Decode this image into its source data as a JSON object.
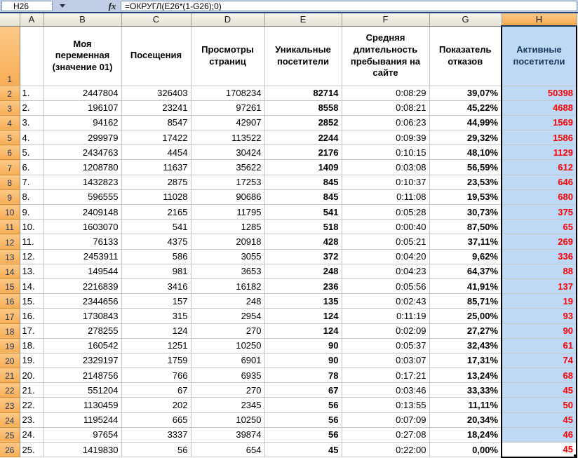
{
  "formula_bar": {
    "name_box": "H26",
    "fx_label": "fx",
    "formula": "=ОКРУГЛ(E26*(1-G26);0)"
  },
  "grid": {
    "column_letters": [
      "A",
      "B",
      "C",
      "D",
      "E",
      "F",
      "G",
      "H"
    ],
    "selected_column": "H",
    "header_row_number": "1",
    "headers": {
      "b": "Моя переменная (значение 01)",
      "c": "Посещения",
      "d": "Просмотры страниц",
      "e": "Уникальные посетители",
      "f": "Средняя длительность пребывания на сайте",
      "g": "Показатель отказов",
      "h": "Активные посетители"
    },
    "rows": [
      {
        "row": "2",
        "a": "1.",
        "b": "2447804",
        "c": "326403",
        "d": "1708234",
        "e": "82714",
        "f": "0:08:29",
        "g": "39,07%",
        "h": "50398"
      },
      {
        "row": "3",
        "a": "2.",
        "b": "196107",
        "c": "23241",
        "d": "97261",
        "e": "8558",
        "f": "0:08:21",
        "g": "45,22%",
        "h": "4688"
      },
      {
        "row": "4",
        "a": "3.",
        "b": "94162",
        "c": "8547",
        "d": "42907",
        "e": "2852",
        "f": "0:06:23",
        "g": "44,99%",
        "h": "1569"
      },
      {
        "row": "5",
        "a": "4.",
        "b": "299979",
        "c": "17422",
        "d": "113522",
        "e": "2244",
        "f": "0:09:39",
        "g": "29,32%",
        "h": "1586"
      },
      {
        "row": "6",
        "a": "5.",
        "b": "2434763",
        "c": "4454",
        "d": "30424",
        "e": "2176",
        "f": "0:10:15",
        "g": "48,10%",
        "h": "1129"
      },
      {
        "row": "7",
        "a": "6.",
        "b": "1208780",
        "c": "11637",
        "d": "35622",
        "e": "1409",
        "f": "0:03:08",
        "g": "56,59%",
        "h": "612"
      },
      {
        "row": "8",
        "a": "7.",
        "b": "1432823",
        "c": "2875",
        "d": "17253",
        "e": "845",
        "f": "0:10:37",
        "g": "23,53%",
        "h": "646"
      },
      {
        "row": "9",
        "a": "8.",
        "b": "596555",
        "c": "11028",
        "d": "90686",
        "e": "845",
        "f": "0:11:08",
        "g": "19,53%",
        "h": "680"
      },
      {
        "row": "10",
        "a": "9.",
        "b": "2409148",
        "c": "2165",
        "d": "11795",
        "e": "541",
        "f": "0:05:28",
        "g": "30,73%",
        "h": "375"
      },
      {
        "row": "11",
        "a": "10.",
        "b": "1603070",
        "c": "541",
        "d": "1285",
        "e": "518",
        "f": "0:00:40",
        "g": "87,50%",
        "h": "65"
      },
      {
        "row": "12",
        "a": "11.",
        "b": "76133",
        "c": "4375",
        "d": "20918",
        "e": "428",
        "f": "0:05:21",
        "g": "37,11%",
        "h": "269"
      },
      {
        "row": "13",
        "a": "12.",
        "b": "2453911",
        "c": "586",
        "d": "3055",
        "e": "372",
        "f": "0:04:20",
        "g": "9,62%",
        "h": "336"
      },
      {
        "row": "14",
        "a": "13.",
        "b": "149544",
        "c": "981",
        "d": "3653",
        "e": "248",
        "f": "0:04:23",
        "g": "64,37%",
        "h": "88"
      },
      {
        "row": "15",
        "a": "14.",
        "b": "2216839",
        "c": "3416",
        "d": "16182",
        "e": "236",
        "f": "0:05:56",
        "g": "41,91%",
        "h": "137"
      },
      {
        "row": "16",
        "a": "15.",
        "b": "2344656",
        "c": "157",
        "d": "248",
        "e": "135",
        "f": "0:02:43",
        "g": "85,71%",
        "h": "19"
      },
      {
        "row": "17",
        "a": "16.",
        "b": "1730843",
        "c": "315",
        "d": "2954",
        "e": "124",
        "f": "0:11:19",
        "g": "25,00%",
        "h": "93"
      },
      {
        "row": "18",
        "a": "17.",
        "b": "278255",
        "c": "124",
        "d": "270",
        "e": "124",
        "f": "0:02:09",
        "g": "27,27%",
        "h": "90"
      },
      {
        "row": "19",
        "a": "18.",
        "b": "160542",
        "c": "1251",
        "d": "10250",
        "e": "90",
        "f": "0:05:37",
        "g": "32,43%",
        "h": "61"
      },
      {
        "row": "20",
        "a": "19.",
        "b": "2329197",
        "c": "1759",
        "d": "6901",
        "e": "90",
        "f": "0:03:07",
        "g": "17,31%",
        "h": "74"
      },
      {
        "row": "21",
        "a": "20.",
        "b": "2148756",
        "c": "766",
        "d": "6935",
        "e": "78",
        "f": "0:17:21",
        "g": "13,24%",
        "h": "68"
      },
      {
        "row": "22",
        "a": "21.",
        "b": "551204",
        "c": "67",
        "d": "270",
        "e": "67",
        "f": "0:03:46",
        "g": "33,33%",
        "h": "45"
      },
      {
        "row": "23",
        "a": "22.",
        "b": "1130459",
        "c": "202",
        "d": "2345",
        "e": "56",
        "f": "0:13:55",
        "g": "11,11%",
        "h": "50"
      },
      {
        "row": "24",
        "a": "23.",
        "b": "1195244",
        "c": "665",
        "d": "10250",
        "e": "56",
        "f": "0:07:09",
        "g": "20,34%",
        "h": "45"
      },
      {
        "row": "25",
        "a": "24.",
        "b": "97654",
        "c": "3337",
        "d": "39874",
        "e": "56",
        "f": "0:27:08",
        "g": "18,24%",
        "h": "46"
      },
      {
        "row": "26",
        "a": "25.",
        "b": "1419830",
        "c": "56",
        "d": "654",
        "e": "45",
        "f": "0:22:00",
        "g": "0,00%",
        "h": "45"
      }
    ]
  },
  "colors": {
    "selection_fill": "#bdd9f5",
    "selected_header_orange": "#f7ad55",
    "header_beige": "#ebe9db",
    "negative_value_red": "#ff0000",
    "gridline": "#c6c6c6",
    "formula_bar_bg": "#c1cde4",
    "selection_border": "#000000",
    "header_text_navy": "#17375d"
  }
}
